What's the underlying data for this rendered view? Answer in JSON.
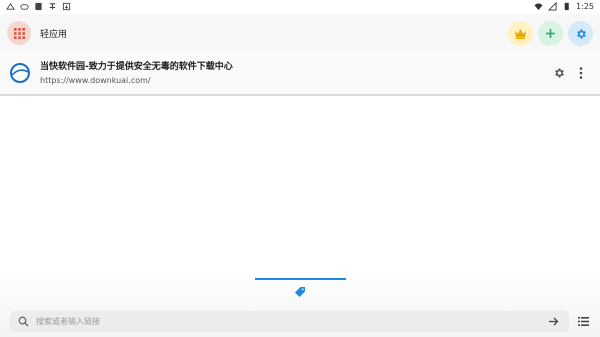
{
  "status_bar": {
    "time": "1:25",
    "left_icons": [
      "notification-icon",
      "cloud-icon",
      "sim-icon",
      "app-logo-icon",
      "download-icon"
    ],
    "right_icons": [
      "wifi-icon",
      "signal-icon",
      "battery-icon"
    ]
  },
  "app_bar": {
    "title": "轻应用",
    "menu_icon": "grid-icon",
    "accent_colors": {
      "menu": "#f6d6d3",
      "crown": "#fff1c2",
      "plus": "#d7f3e3",
      "settings": "#d5e9f8"
    }
  },
  "items": [
    {
      "title": "当快软件园-致力于提供安全无毒的软件下载中心",
      "url": "https://www.downkuai.com/",
      "logo_letter": "D"
    }
  ],
  "search": {
    "placeholder": "搜索或者输入链接",
    "value": ""
  },
  "colors": {
    "tab_indicator": "#1e88e5",
    "logo": "#1a6fc4"
  }
}
